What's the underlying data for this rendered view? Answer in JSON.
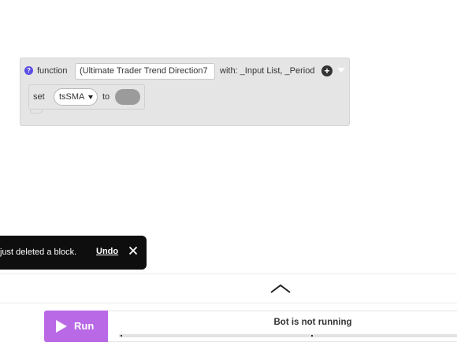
{
  "function_block": {
    "label": "function",
    "name_value": "(Ultimate Trader Trend Direction7",
    "params_text": "with: _Input List, _Period",
    "help_icon_glyph": "?",
    "add_icon_glyph": "+"
  },
  "set_block": {
    "label": "set",
    "variable": "tsSMA",
    "to_label": "to"
  },
  "toast": {
    "message": "just deleted a block.",
    "undo_label": "Undo"
  },
  "run_panel": {
    "run_label": "Run",
    "status": "Bot is not running"
  },
  "colors": {
    "run_button": "#b969e6",
    "help_icon": "#5b4ee3",
    "block_bg": "#e5e5e5",
    "toast_bg": "#0e0e0e"
  }
}
